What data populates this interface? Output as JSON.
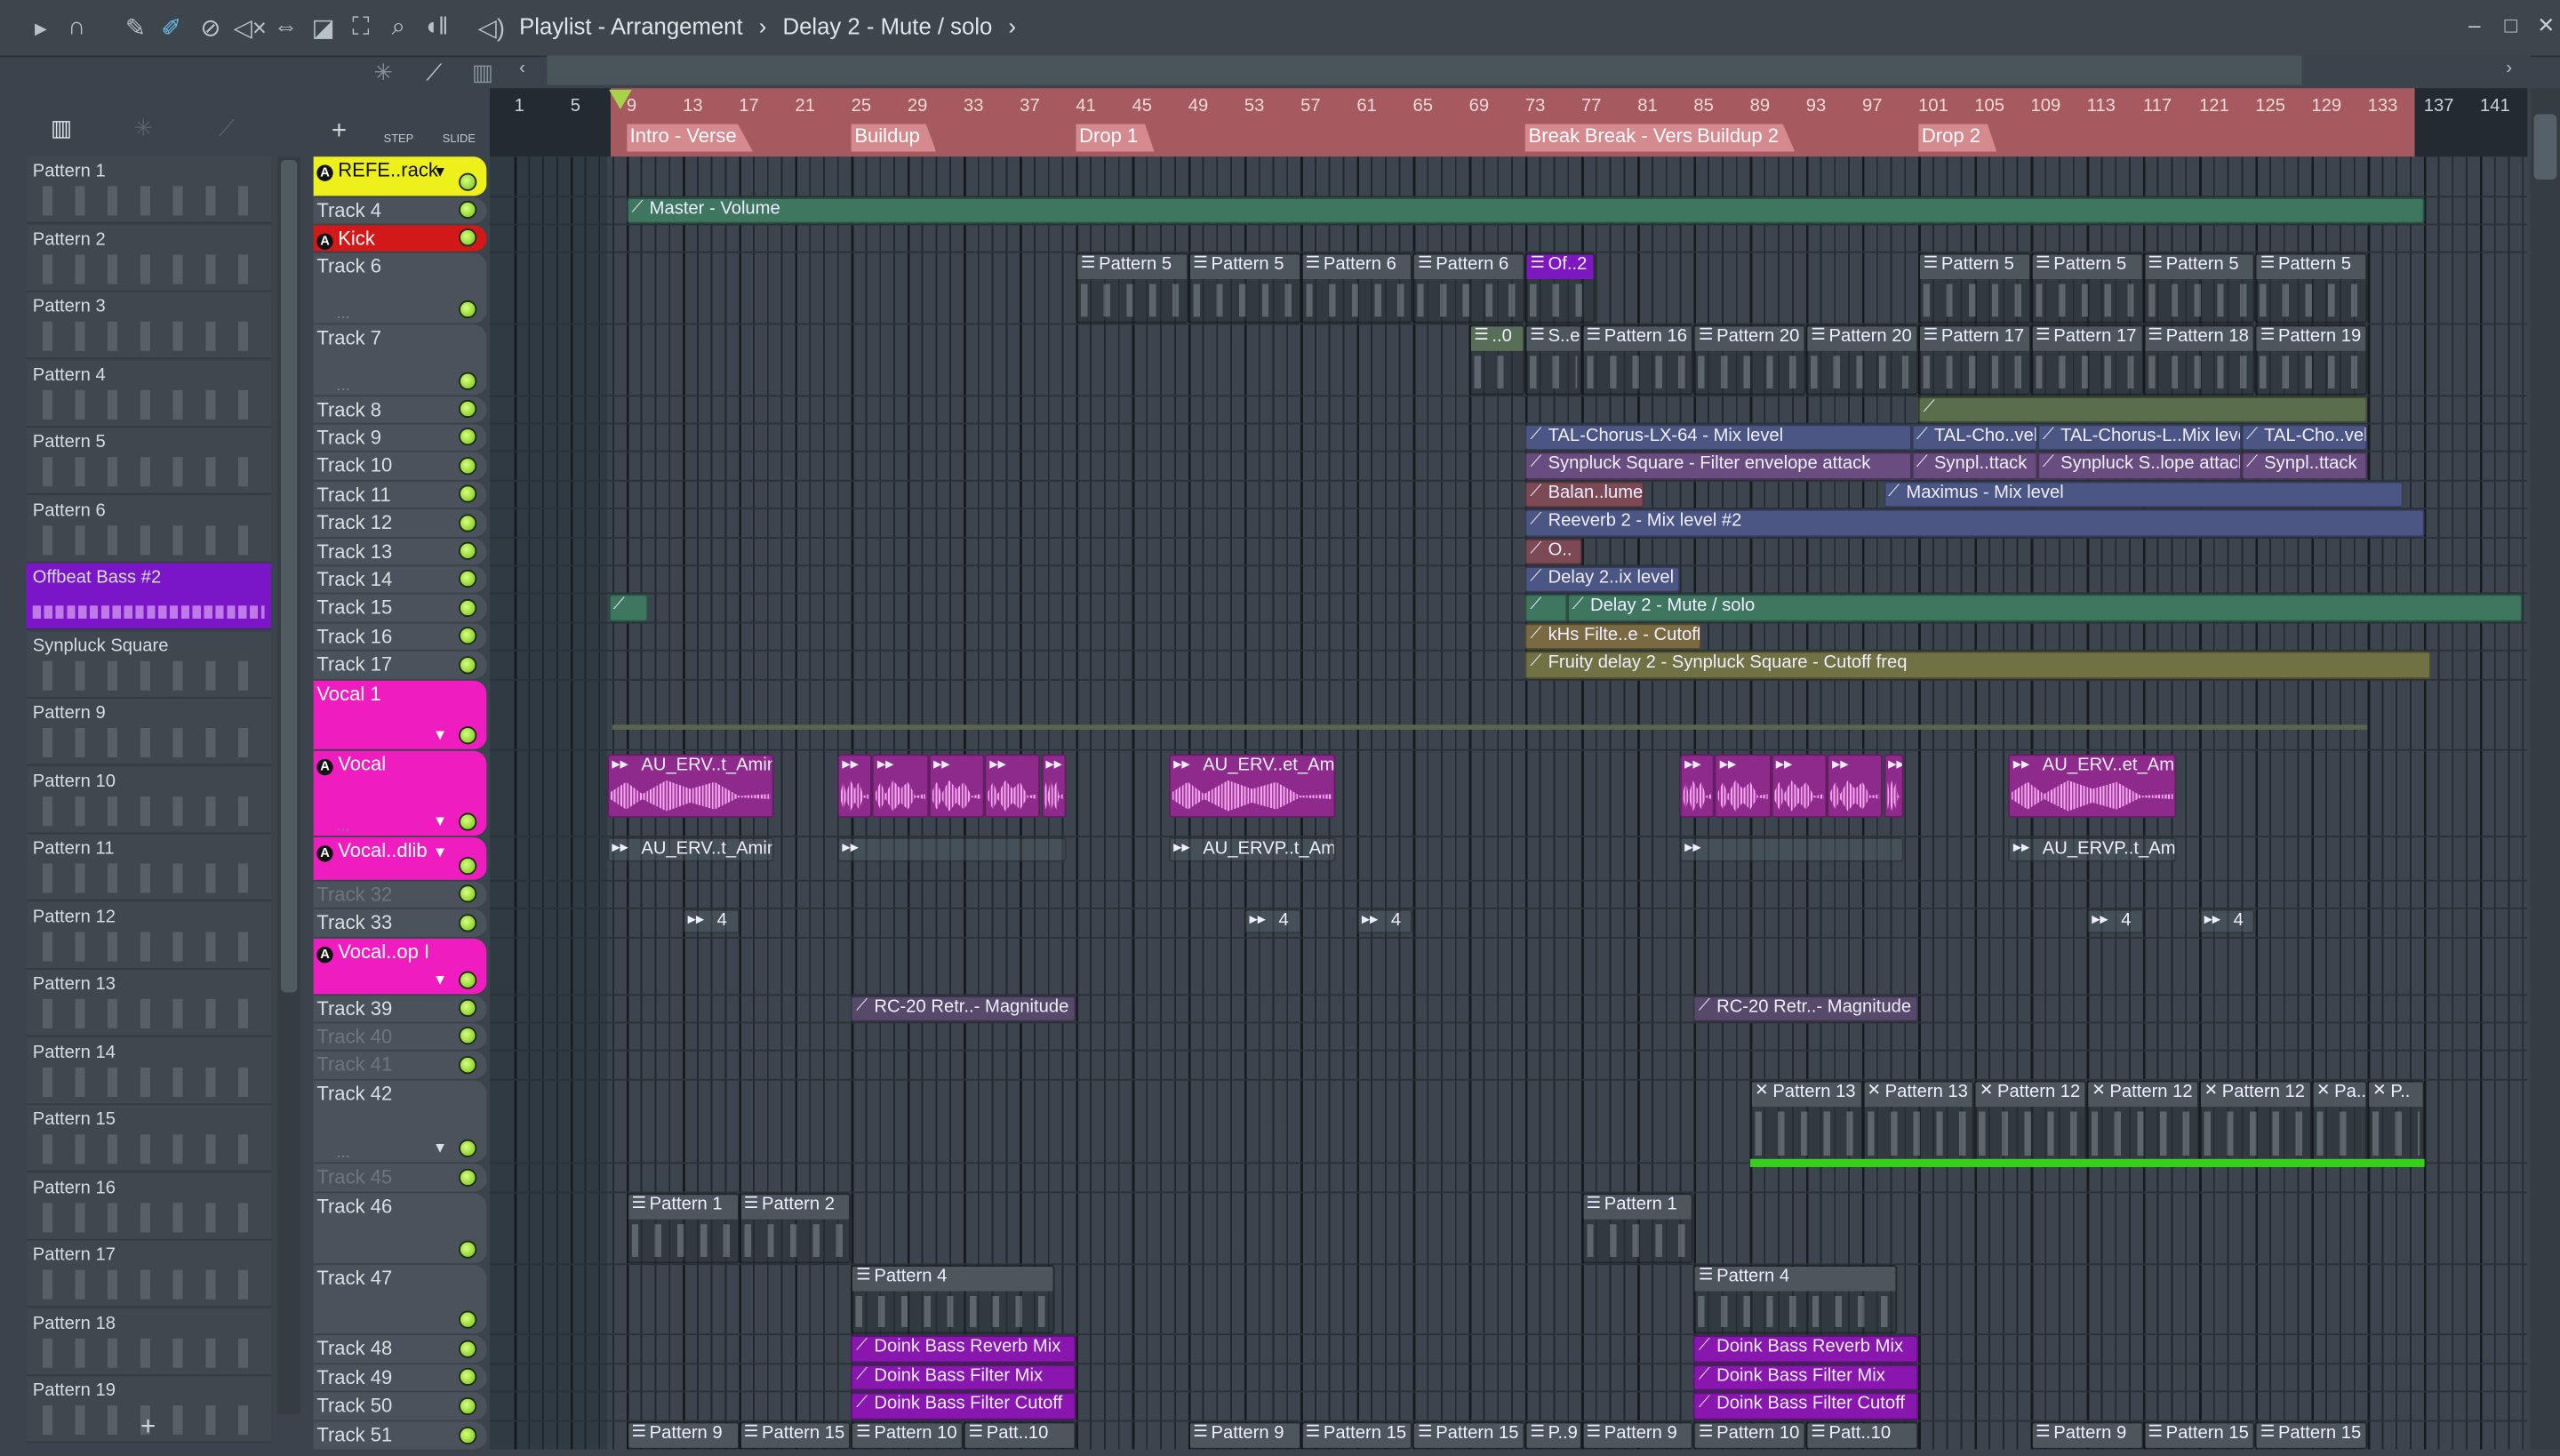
{
  "toolbar": {
    "icons": [
      "play-arrow",
      "magnet",
      "pencil",
      "paint-brush",
      "delete",
      "mute",
      "slip",
      "slice",
      "select",
      "zoom",
      "playback"
    ],
    "title": "Playlist - Arrangement",
    "separator": "›",
    "subtitle": "Delay 2 - Mute / solo",
    "win_minimize": "–",
    "win_maximize": "□",
    "win_close": "✕"
  },
  "side_tools": {
    "step": "STEP",
    "slide": "SLIDE",
    "add": "+"
  },
  "picker": {
    "add": "+",
    "items": [
      {
        "label": "Pattern 1"
      },
      {
        "label": "Pattern 2"
      },
      {
        "label": "Pattern 3"
      },
      {
        "label": "Pattern 4"
      },
      {
        "label": "Pattern 5"
      },
      {
        "label": "Pattern 6"
      },
      {
        "label": "Offbeat Bass #2",
        "selected": true
      },
      {
        "label": "Synpluck Square"
      },
      {
        "label": "Pattern 9"
      },
      {
        "label": "Pattern 10"
      },
      {
        "label": "Pattern 11"
      },
      {
        "label": "Pattern 12"
      },
      {
        "label": "Pattern 13"
      },
      {
        "label": "Pattern 14"
      },
      {
        "label": "Pattern 15"
      },
      {
        "label": "Pattern 16"
      },
      {
        "label": "Pattern 17"
      },
      {
        "label": "Pattern 18"
      },
      {
        "label": "Pattern 19"
      }
    ]
  },
  "ruler": {
    "ticks": [
      1,
      5,
      9,
      13,
      17,
      21,
      25,
      29,
      33,
      37,
      41,
      45,
      49,
      53,
      57,
      61,
      65,
      69,
      73,
      77,
      81,
      85,
      89,
      93,
      97,
      101,
      105,
      109,
      113,
      117,
      121,
      125,
      129,
      133,
      137,
      141
    ],
    "markers": [
      {
        "label": "Intro - Verse",
        "bar": 9
      },
      {
        "label": "Buildup",
        "bar": 25
      },
      {
        "label": "Drop 1",
        "bar": 41
      },
      {
        "label": "Break",
        "bar": 73
      },
      {
        "label": "Break - Vers",
        "bar": 77
      },
      {
        "label": "Buildup 2",
        "bar": 85
      },
      {
        "label": "Drop 2",
        "bar": 101
      }
    ],
    "playhead_bar": 8.5
  },
  "colors": {
    "yellow": "#eef01c",
    "red": "#d21818",
    "pink": "#ef1cbf",
    "purple": "#7d18c0",
    "auto_green": "#3f7660",
    "auto_blue": "#4c5684",
    "auto_violet": "#6a4d80",
    "auto_brown": "#7c4a55",
    "auto_olive": "#707244",
    "auto_tan": "#7a6a42",
    "audio": "#8f2a8d",
    "doink": "#8a16b0"
  },
  "tracks": [
    {
      "name": "REFE..rack",
      "color": "#eef01c",
      "text": "#111",
      "icon": "A",
      "dropdown": true
    },
    {
      "name": "Track 4"
    },
    {
      "name": "Kick",
      "color": "#d21818",
      "text": "#fff",
      "icon": "A"
    },
    {
      "name": "Track 6",
      "dots": "..."
    },
    {
      "name": "Track 7",
      "dots": "..."
    },
    {
      "name": "Track 8"
    },
    {
      "name": "Track 9"
    },
    {
      "name": "Track 10"
    },
    {
      "name": "Track 11"
    },
    {
      "name": "Track 12"
    },
    {
      "name": "Track 13"
    },
    {
      "name": "Track 14"
    },
    {
      "name": "Track 15"
    },
    {
      "name": "Track 16"
    },
    {
      "name": "Track 17"
    },
    {
      "name": "Vocal 1",
      "color": "#ef1cbf",
      "text": "#fff",
      "dropdown": true
    },
    {
      "name": "Vocal",
      "color": "#ef1cbf",
      "text": "#fff",
      "icon": "A",
      "dropdown": true,
      "dots": "..."
    },
    {
      "name": "Vocal..dlib",
      "color": "#ef1cbf",
      "text": "#fff",
      "icon": "A",
      "dropdown": true
    },
    {
      "name": "Track 32",
      "dim": true
    },
    {
      "name": "Track 33"
    },
    {
      "name": "Vocal..op I",
      "color": "#ef1cbf",
      "text": "#fff",
      "icon": "A",
      "dropdown": true
    },
    {
      "name": "Track 39"
    },
    {
      "name": "Track 40",
      "dim": true
    },
    {
      "name": "Track 41",
      "dim": true
    },
    {
      "name": "Track 42",
      "dropdown": true,
      "dots": "..."
    },
    {
      "name": "Track 45",
      "dim": true
    },
    {
      "name": "Track 46"
    },
    {
      "name": "Track 47"
    },
    {
      "name": "Track 48"
    },
    {
      "name": "Track 49"
    },
    {
      "name": "Track 50"
    },
    {
      "name": "Track 51"
    }
  ],
  "clips": [
    {
      "t": 1,
      "s": 9,
      "e": 137,
      "type": "auto",
      "c": "#3f7660",
      "label": "Master - Volume"
    },
    {
      "t": 3,
      "s": 41,
      "e": 49,
      "type": "pattern",
      "label": "Pattern 5"
    },
    {
      "t": 3,
      "s": 49,
      "e": 57,
      "type": "pattern",
      "label": "Pattern 5"
    },
    {
      "t": 3,
      "s": 57,
      "e": 65,
      "type": "pattern",
      "label": "Pattern 6"
    },
    {
      "t": 3,
      "s": 65,
      "e": 73,
      "type": "pattern",
      "label": "Pattern 6"
    },
    {
      "t": 3,
      "s": 73,
      "e": 78,
      "type": "pattern",
      "c": "#7d18c0",
      "label": "Of..2"
    },
    {
      "t": 3,
      "s": 101,
      "e": 109,
      "type": "pattern",
      "label": "Pattern 5"
    },
    {
      "t": 3,
      "s": 109,
      "e": 117,
      "type": "pattern",
      "label": "Pattern 5"
    },
    {
      "t": 3,
      "s": 117,
      "e": 125,
      "type": "pattern",
      "label": "Pattern 5"
    },
    {
      "t": 3,
      "s": 125,
      "e": 133,
      "type": "pattern",
      "label": "Pattern 5"
    },
    {
      "t": 4,
      "s": 69,
      "e": 73,
      "type": "pattern",
      "c": "#586e56",
      "label": "..0"
    },
    {
      "t": 4,
      "s": 73,
      "e": 77,
      "type": "pattern",
      "label": "S..e"
    },
    {
      "t": 4,
      "s": 77,
      "e": 85,
      "type": "pattern",
      "label": "Pattern 16"
    },
    {
      "t": 4,
      "s": 85,
      "e": 93,
      "type": "pattern",
      "label": "Pattern 20"
    },
    {
      "t": 4,
      "s": 93,
      "e": 101,
      "type": "pattern",
      "label": "Pattern 20"
    },
    {
      "t": 4,
      "s": 101,
      "e": 109,
      "type": "pattern",
      "label": "Pattern 17"
    },
    {
      "t": 4,
      "s": 109,
      "e": 117,
      "type": "pattern",
      "label": "Pattern 17"
    },
    {
      "t": 4,
      "s": 117,
      "e": 125,
      "type": "pattern",
      "label": "Pattern 18"
    },
    {
      "t": 4,
      "s": 125,
      "e": 133,
      "type": "pattern",
      "label": "Pattern 19"
    },
    {
      "t": 5,
      "s": 101,
      "e": 133,
      "type": "auto",
      "c": "#5b6e4c",
      "label": ""
    },
    {
      "t": 6,
      "s": 73,
      "e": 100.5,
      "type": "auto",
      "c": "#4c5684",
      "label": "TAL-Chorus-LX-64 - Mix level"
    },
    {
      "t": 6,
      "s": 100.5,
      "e": 109.5,
      "type": "auto",
      "c": "#4c5684",
      "label": "TAL-Cho..vel"
    },
    {
      "t": 6,
      "s": 109.5,
      "e": 124,
      "type": "auto",
      "c": "#4c5684",
      "label": "TAL-Chorus-L..Mix level"
    },
    {
      "t": 6,
      "s": 124,
      "e": 133,
      "type": "auto",
      "c": "#4c5684",
      "label": "TAL-Cho..vel"
    },
    {
      "t": 7,
      "s": 73,
      "e": 100.5,
      "type": "auto",
      "c": "#6a4d80",
      "label": "Synpluck Square - Filter envelope attack"
    },
    {
      "t": 7,
      "s": 100.5,
      "e": 109.5,
      "type": "auto",
      "c": "#6a4d80",
      "label": "Synpl..ttack"
    },
    {
      "t": 7,
      "s": 109.5,
      "e": 124,
      "type": "auto",
      "c": "#6a4d80",
      "label": "Synpluck S..lope attack"
    },
    {
      "t": 7,
      "s": 124,
      "e": 133,
      "type": "auto",
      "c": "#6a4d80",
      "label": "Synpl..ttack"
    },
    {
      "t": 8,
      "s": 73,
      "e": 81.5,
      "type": "auto",
      "c": "#7c4a55",
      "label": "Balan..lume"
    },
    {
      "t": 8,
      "s": 98.5,
      "e": 135.5,
      "type": "auto",
      "c": "#4c5684",
      "label": "Maximus - Mix level"
    },
    {
      "t": 9,
      "s": 73,
      "e": 137,
      "type": "auto",
      "c": "#4c5684",
      "label": "Reeverb 2 - Mix level #2"
    },
    {
      "t": 10,
      "s": 73,
      "e": 77,
      "type": "auto",
      "c": "#7c4a55",
      "label": "O.."
    },
    {
      "t": 11,
      "s": 73,
      "e": 84,
      "type": "auto",
      "c": "#4c5684",
      "label": "Delay 2..ix level"
    },
    {
      "t": 12,
      "s": 7.7,
      "e": 10.5,
      "type": "auto",
      "c": "#3f7660",
      "label": ""
    },
    {
      "t": 12,
      "s": 73,
      "e": 76,
      "type": "auto",
      "c": "#3f7660",
      "label": ""
    },
    {
      "t": 12,
      "s": 76,
      "e": 144,
      "type": "auto",
      "c": "#3f7660",
      "label": "Delay 2 - Mute / solo"
    },
    {
      "t": 13,
      "s": 73,
      "e": 85.5,
      "type": "auto",
      "c": "#7a6a42",
      "label": "kHs Filte..e - Cutoff"
    },
    {
      "t": 14,
      "s": 73,
      "e": 137.5,
      "type": "auto",
      "c": "#707244",
      "label": "Fruity delay 2 - Synpluck Square - Cutoff freq"
    },
    {
      "t": 16,
      "s": 7.6,
      "e": 19.5,
      "type": "audio",
      "label": "AU_ERV..t_Amin"
    },
    {
      "t": 16,
      "s": 24,
      "e": 26.5,
      "type": "audio",
      "label": ""
    },
    {
      "t": 16,
      "s": 26.5,
      "e": 30.5,
      "type": "audio",
      "label": ""
    },
    {
      "t": 16,
      "s": 30.5,
      "e": 34.5,
      "type": "audio",
      "label": ""
    },
    {
      "t": 16,
      "s": 34.5,
      "e": 38.5,
      "type": "audio",
      "label": ""
    },
    {
      "t": 16,
      "s": 38.5,
      "e": 40.3,
      "type": "audio",
      "label": ""
    },
    {
      "t": 16,
      "s": 47.6,
      "e": 59.5,
      "type": "audio",
      "label": "AU_ERV..et_Amin"
    },
    {
      "t": 16,
      "s": 84,
      "e": 86.5,
      "type": "audio",
      "label": ""
    },
    {
      "t": 16,
      "s": 86.5,
      "e": 90.5,
      "type": "audio",
      "label": ""
    },
    {
      "t": 16,
      "s": 90.5,
      "e": 94.5,
      "type": "audio",
      "label": ""
    },
    {
      "t": 16,
      "s": 94.5,
      "e": 98.5,
      "type": "audio",
      "label": ""
    },
    {
      "t": 16,
      "s": 98.5,
      "e": 100,
      "type": "audio",
      "label": ""
    },
    {
      "t": 16,
      "s": 107.4,
      "e": 119.4,
      "type": "audio",
      "label": "AU_ERV..et_Amin"
    },
    {
      "t": 17,
      "s": 7.6,
      "e": 19.5,
      "type": "ghost",
      "label": "AU_ERV..t_Amin"
    },
    {
      "t": 17,
      "s": 24,
      "e": 40.3,
      "type": "ghost",
      "label": ""
    },
    {
      "t": 17,
      "s": 47.6,
      "e": 59.5,
      "type": "ghost",
      "label": "AU_ERVP..t_Amin"
    },
    {
      "t": 17,
      "s": 84,
      "e": 100,
      "type": "ghost",
      "label": ""
    },
    {
      "t": 17,
      "s": 107.4,
      "e": 119.4,
      "type": "ghost",
      "label": "AU_ERVP..t_Amin"
    },
    {
      "t": 19,
      "s": 13,
      "e": 17,
      "type": "ghost",
      "label": "4"
    },
    {
      "t": 19,
      "s": 53,
      "e": 57,
      "type": "ghost",
      "label": "4"
    },
    {
      "t": 19,
      "s": 61,
      "e": 65,
      "type": "ghost",
      "label": "4"
    },
    {
      "t": 19,
      "s": 113,
      "e": 117,
      "type": "ghost",
      "label": "4"
    },
    {
      "t": 19,
      "s": 121,
      "e": 125,
      "type": "ghost",
      "label": "4"
    },
    {
      "t": 21,
      "s": 25,
      "e": 41,
      "type": "auto",
      "c": "#56496a",
      "label": "RC-20 Retr..- Magnitude"
    },
    {
      "t": 21,
      "s": 85,
      "e": 101,
      "type": "auto",
      "c": "#56496a",
      "label": "RC-20 Retr..- Magnitude"
    },
    {
      "t": 24,
      "s": 89,
      "e": 97,
      "type": "pattern",
      "label": "Pattern 13"
    },
    {
      "t": 24,
      "s": 97,
      "e": 105,
      "type": "pattern",
      "label": "Pattern 13"
    },
    {
      "t": 24,
      "s": 105,
      "e": 113,
      "type": "pattern",
      "label": "Pattern 12"
    },
    {
      "t": 24,
      "s": 113,
      "e": 121,
      "type": "pattern",
      "label": "Pattern 12"
    },
    {
      "t": 24,
      "s": 121,
      "e": 129,
      "type": "pattern",
      "label": "Pattern 12"
    },
    {
      "t": 24,
      "s": 129,
      "e": 133,
      "type": "pattern",
      "label": "Pa.."
    },
    {
      "t": 24,
      "s": 133,
      "e": 137,
      "type": "pattern",
      "label": "P.."
    },
    {
      "t": 26,
      "s": 9,
      "e": 17,
      "type": "pattern",
      "label": "Pattern 1"
    },
    {
      "t": 26,
      "s": 17,
      "e": 25,
      "type": "pattern",
      "label": "Pattern 2"
    },
    {
      "t": 26,
      "s": 77,
      "e": 85,
      "type": "pattern",
      "label": "Pattern 1"
    },
    {
      "t": 27,
      "s": 25,
      "e": 39.5,
      "type": "pattern",
      "label": "Pattern 4"
    },
    {
      "t": 27,
      "s": 85,
      "e": 99.5,
      "type": "pattern",
      "label": "Pattern 4"
    },
    {
      "t": 28,
      "s": 25,
      "e": 41,
      "type": "auto",
      "c": "#8a16b0",
      "label": "Doink Bass Reverb Mix"
    },
    {
      "t": 28,
      "s": 85,
      "e": 101,
      "type": "auto",
      "c": "#8a16b0",
      "label": "Doink Bass Reverb Mix"
    },
    {
      "t": 29,
      "s": 25,
      "e": 41,
      "type": "auto",
      "c": "#8a16b0",
      "label": "Doink Bass Filter Mix"
    },
    {
      "t": 29,
      "s": 85,
      "e": 101,
      "type": "auto",
      "c": "#8a16b0",
      "label": "Doink Bass Filter Mix"
    },
    {
      "t": 30,
      "s": 25,
      "e": 41,
      "type": "auto",
      "c": "#8a16b0",
      "label": "Doink Bass Filter Cutoff"
    },
    {
      "t": 30,
      "s": 85,
      "e": 101,
      "type": "auto",
      "c": "#8a16b0",
      "label": "Doink Bass Filter Cutoff"
    },
    {
      "t": 31,
      "s": 9,
      "e": 17,
      "type": "pattern",
      "label": "Pattern 9"
    },
    {
      "t": 31,
      "s": 17,
      "e": 25,
      "type": "pattern",
      "label": "Pattern 15"
    },
    {
      "t": 31,
      "s": 25,
      "e": 33,
      "type": "pattern",
      "label": "Pattern 10"
    },
    {
      "t": 31,
      "s": 33,
      "e": 41,
      "type": "pattern",
      "label": "Patt..10"
    },
    {
      "t": 31,
      "s": 49,
      "e": 57,
      "type": "pattern",
      "label": "Pattern 9"
    },
    {
      "t": 31,
      "s": 57,
      "e": 65,
      "type": "pattern",
      "label": "Pattern 15"
    },
    {
      "t": 31,
      "s": 65,
      "e": 73,
      "type": "pattern",
      "label": "Pattern 15"
    },
    {
      "t": 31,
      "s": 73,
      "e": 77,
      "type": "pattern",
      "label": "P..9"
    },
    {
      "t": 31,
      "s": 77,
      "e": 85,
      "type": "pattern",
      "label": "Pattern 9"
    },
    {
      "t": 31,
      "s": 85,
      "e": 93,
      "type": "pattern",
      "label": "Pattern 10"
    },
    {
      "t": 31,
      "s": 93,
      "e": 101,
      "type": "pattern",
      "label": "Patt..10"
    },
    {
      "t": 31,
      "s": 109,
      "e": 117,
      "type": "pattern",
      "label": "Pattern 9"
    },
    {
      "t": 31,
      "s": 117,
      "e": 125,
      "type": "pattern",
      "label": "Pattern 15"
    },
    {
      "t": 31,
      "s": 125,
      "e": 133,
      "type": "pattern",
      "label": "Pattern 15"
    }
  ]
}
